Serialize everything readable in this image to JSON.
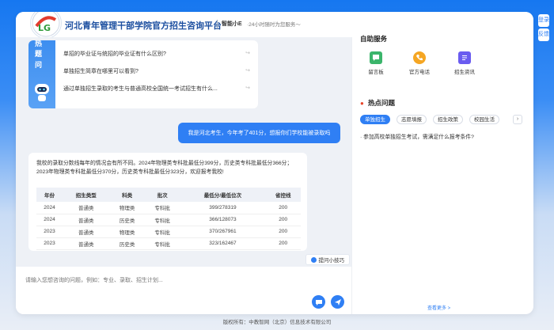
{
  "header": {
    "site_title": "河北青年管理干部学院官方招生咨询平台",
    "bot_name": "智能小E",
    "bot_slogan": "·24小时随时为您服务～"
  },
  "hot_banner": {
    "chars": [
      "热",
      "题",
      "问"
    ]
  },
  "hot_questions": [
    "单招的毕业证与统招的毕业证有什么区别?",
    "单独招生简章在哪里可以看到?",
    "通过单独招生录取的考生与普通高校全国统一考试招生有什么..."
  ],
  "user_message": "我是河北考生，今年考了401分，想报你们学校能被录取吗",
  "bot_reply": {
    "text": "我校的录取分数线每年的情况会有所不同。2024年物理类专科批最低分399分，历史类专科批最低分366分；2023年物理类专科批最低分370分，历史类专科批最低分323分，欢迎报考我校!",
    "columns": [
      "年份",
      "招生类型",
      "科类",
      "批次",
      "最低分/最低位次",
      "省控线"
    ],
    "rows": [
      [
        "2024",
        "普通类",
        "物理类",
        "专科批",
        "399/278319",
        "200"
      ],
      [
        "2024",
        "普通类",
        "历史类",
        "专科批",
        "366/128073",
        "200"
      ],
      [
        "2023",
        "普通类",
        "物理类",
        "专科批",
        "370/267961",
        "200"
      ],
      [
        "2023",
        "普通类",
        "历史类",
        "专科批",
        "323/162467",
        "200"
      ]
    ]
  },
  "tips_button": "提问小技巧",
  "input": {
    "placeholder": "请输入您想咨询的问题，例如：专业、录取、招生计划..."
  },
  "sidebar": {
    "services_title": "自助服务",
    "services": [
      {
        "label": "留言板",
        "icon": "message-board-icon",
        "color": "#3bb56b"
      },
      {
        "label": "官方电话",
        "icon": "phone-icon",
        "color": "#f5a623"
      },
      {
        "label": "招生资讯",
        "icon": "news-icon",
        "color": "#6a5cf0"
      }
    ],
    "hot_title": "热点问题",
    "tabs": [
      "单独招生",
      "志愿填报",
      "招生政策",
      "校园生活"
    ],
    "tab_more": "›",
    "question": "· 参加高校单独招生考试，需满足什么报考条件?",
    "view_more": "查看更多 >"
  },
  "float_buttons": [
    "登录",
    "反馈"
  ],
  "footer": "版权所有：中教智网（北京）信息技术有限公司",
  "colors": {
    "primary": "#2f7ff4",
    "title": "#1c4fa0",
    "hot": "#e8462b"
  }
}
